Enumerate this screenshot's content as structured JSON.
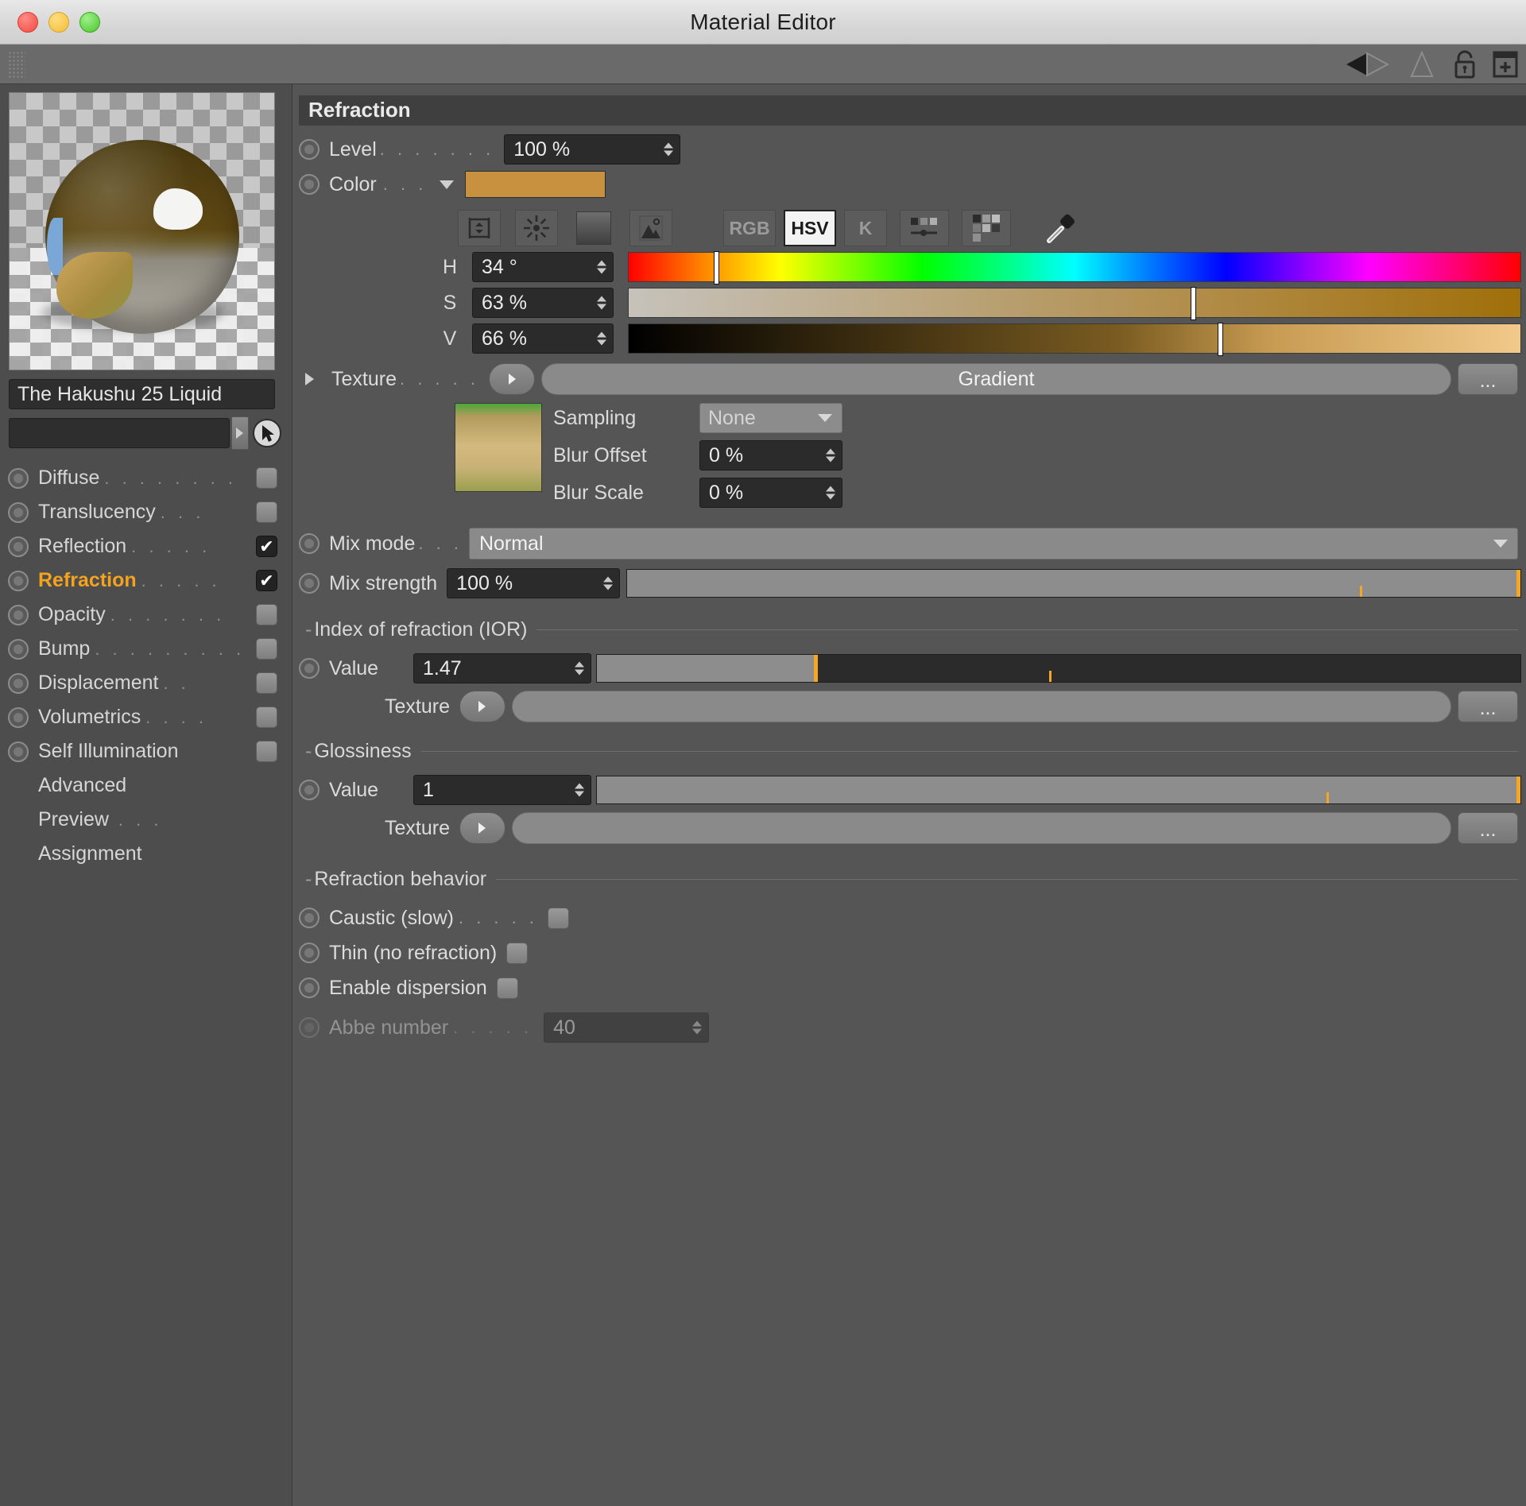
{
  "window": {
    "title": "Material Editor",
    "traffic_lights": [
      "close-red",
      "minimize-yellow",
      "maximize-green"
    ]
  },
  "toolstrip": {
    "grip": "grip-dots",
    "icons": [
      "play-back-arrow",
      "play-forward-arrow",
      "lock-icon",
      "add-panel-icon"
    ]
  },
  "sidebar": {
    "material_name": "The Hakushu 25 Liquid",
    "search_value": "",
    "channels": [
      {
        "label": "Diffuse",
        "dots": ". . . . . . . .",
        "checked": false,
        "active": false
      },
      {
        "label": "Translucency",
        "dots": ". . .",
        "checked": false,
        "active": false
      },
      {
        "label": "Reflection",
        "dots": ". . . . .",
        "checked": true,
        "active": false
      },
      {
        "label": "Refraction",
        "dots": ". . . . .",
        "checked": true,
        "active": true
      },
      {
        "label": "Opacity",
        "dots": ". . . . . . .",
        "checked": false,
        "active": false
      },
      {
        "label": "Bump",
        "dots": ". . . . . . . . .",
        "checked": false,
        "active": false
      },
      {
        "label": "Displacement",
        "dots": ". .",
        "checked": false,
        "active": false
      },
      {
        "label": "Volumetrics",
        "dots": ". . . .",
        "checked": false,
        "active": false
      },
      {
        "label": "Self Illumination",
        "dots": "",
        "checked": false,
        "active": false
      }
    ],
    "plain_items": [
      {
        "label": "Advanced",
        "dots": ""
      },
      {
        "label": "Preview",
        "dots": ". . ."
      },
      {
        "label": "Assignment",
        "dots": ""
      }
    ]
  },
  "panel": {
    "section_title": "Refraction",
    "level": {
      "label": "Level",
      "dots": ". . . . . . .",
      "value": "100 %"
    },
    "color": {
      "label": "Color",
      "dots": ". . .",
      "swatch_hex": "#c8913f",
      "modes": [
        {
          "name": "eyedropper-range-icon",
          "label": "",
          "active": false
        },
        {
          "name": "color-wheel-icon",
          "label": "",
          "active": false
        },
        {
          "name": "gradient-square-icon",
          "label": "",
          "active": false
        },
        {
          "name": "image-picker-icon",
          "label": "",
          "active": false
        },
        {
          "name": "rgb-mode-button",
          "label": "RGB",
          "active": false
        },
        {
          "name": "hsv-mode-button",
          "label": "HSV",
          "active": true
        },
        {
          "name": "kelvin-mode-button",
          "label": "K",
          "active": false
        },
        {
          "name": "mixer-mode-icon",
          "label": "",
          "active": false
        },
        {
          "name": "swatches-mode-icon",
          "label": "",
          "active": false
        },
        {
          "name": "eyedropper-icon",
          "label": "",
          "active": false
        }
      ],
      "hsv": [
        {
          "letter": "H",
          "value": "34 °",
          "knob_pct": 9.5
        },
        {
          "letter": "S",
          "value": "63 %",
          "knob_pct": 63
        },
        {
          "letter": "V",
          "value": "66 %",
          "knob_pct": 66
        }
      ]
    },
    "texture": {
      "label": "Texture",
      "dots": ". . . . .",
      "value": "Gradient",
      "dots_button": "...",
      "sampling": {
        "label": "Sampling",
        "value": "None"
      },
      "blur_offset": {
        "label": "Blur Offset",
        "value": "0 %"
      },
      "blur_scale": {
        "label": "Blur Scale",
        "value": "0 %"
      }
    },
    "mix_mode": {
      "label": "Mix mode",
      "dots": ". . .",
      "value": "Normal"
    },
    "mix_strength": {
      "label": "Mix strength",
      "value": "100 %",
      "fill_pct": 100,
      "tick_pct": 82
    },
    "ior": {
      "group": "Index of refraction (IOR)",
      "value_label": "Value",
      "value": "1.47",
      "fill_pct": 23.5,
      "tick_pct": 49,
      "texture_label": "Texture",
      "texture_value": "",
      "dots_button": "..."
    },
    "glossiness": {
      "group": "Glossiness",
      "value_label": "Value",
      "value": "1",
      "fill_pct": 100,
      "tick_pct": 79,
      "texture_label": "Texture",
      "texture_value": "",
      "dots_button": "..."
    },
    "behavior": {
      "group": "Refraction behavior",
      "rows": [
        {
          "label": "Caustic (slow)",
          "dots": ". . . . .",
          "checked": false,
          "disabled": false
        },
        {
          "label": "Thin (no refraction)",
          "dots": "",
          "checked": false,
          "disabled": false
        },
        {
          "label": "Enable dispersion",
          "dots": "",
          "checked": false,
          "disabled": false
        }
      ],
      "abbe": {
        "label": "Abbe number",
        "dots": ". . . . .",
        "value": "40",
        "disabled": true
      }
    }
  }
}
